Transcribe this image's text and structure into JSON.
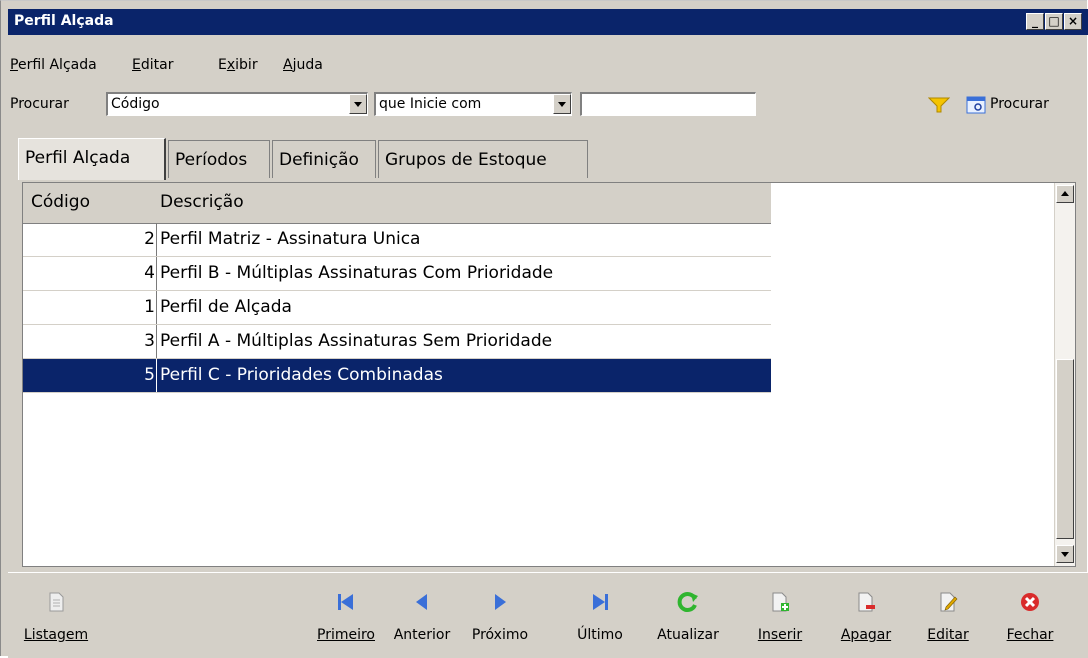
{
  "window": {
    "title": "Perfil Alçada"
  },
  "menu": [
    {
      "label": "Perfil Alçada",
      "u": "P",
      "rest": "erfil Alçada"
    },
    {
      "label": "Editar",
      "u": "E",
      "rest": "ditar"
    },
    {
      "label": "Exibir",
      "pre": "E",
      "u": "x",
      "rest": "ibir"
    },
    {
      "label": "Ajuda",
      "u": "A",
      "rest": "juda"
    }
  ],
  "search": {
    "label": "Procurar",
    "field": "Código",
    "mode": "que Inicie com",
    "text": "",
    "button_label": "Procurar"
  },
  "tabs": [
    "Perfil Alçada",
    "Períodos",
    "Definição",
    "Grupos de Estoque"
  ],
  "grid": {
    "columns": [
      "Código",
      "Descrição"
    ],
    "rows": [
      {
        "code": "2",
        "desc": "Perfil Matriz - Assinatura Unica"
      },
      {
        "code": "4",
        "desc": "Perfil B - Múltiplas Assinaturas Com Prioridade"
      },
      {
        "code": "1",
        "desc": "Perfil de Alçada"
      },
      {
        "code": "3",
        "desc": "Perfil A - Múltiplas Assinaturas Sem Prioridade"
      },
      {
        "code": "5",
        "desc": "Perfil C - Prioridades Combinadas"
      }
    ],
    "selected_index": 4
  },
  "actions": {
    "listagem": "Listagem",
    "primeiro": "Primeiro",
    "anterior": "Anterior",
    "proximo": "Próximo",
    "ultimo": "Último",
    "atualizar": "Atualizar",
    "inserir": "Inserir",
    "apagar": "Apagar",
    "editar": "Editar",
    "fechar": "Fechar"
  },
  "colors": {
    "titlebar": "#0a246a",
    "selection": "#0a246a",
    "nav_blue": "#3a6fd8",
    "refresh_green": "#2fb52f",
    "close_red": "#d92b2b"
  }
}
